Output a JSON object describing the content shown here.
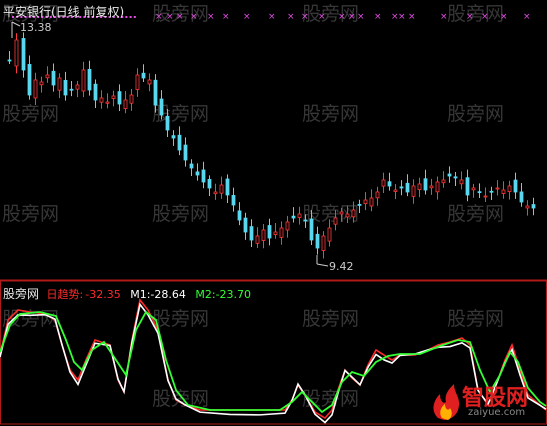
{
  "title": "平安银行(日线 前复权)",
  "price_high_label": "13.38",
  "price_low_label": "9.42",
  "indicator": {
    "name": "股旁网",
    "line1": {
      "label": "日趋势:",
      "value": "-32.35",
      "color": "#ff2a2a"
    },
    "line2": {
      "label": "M1:",
      "value": "-28.64",
      "color": "#ffffff"
    },
    "line3": {
      "label": "M2:",
      "value": "-23.70",
      "color": "#33ff33"
    }
  },
  "watermark": "股旁网",
  "logo": {
    "text": "智股网",
    "url": "zaiyue.com"
  },
  "colors": {
    "up": "#ff3b3b",
    "down": "#5ad7ee",
    "marker": "#e64ce6",
    "divider": "#b01a1a"
  }
}
